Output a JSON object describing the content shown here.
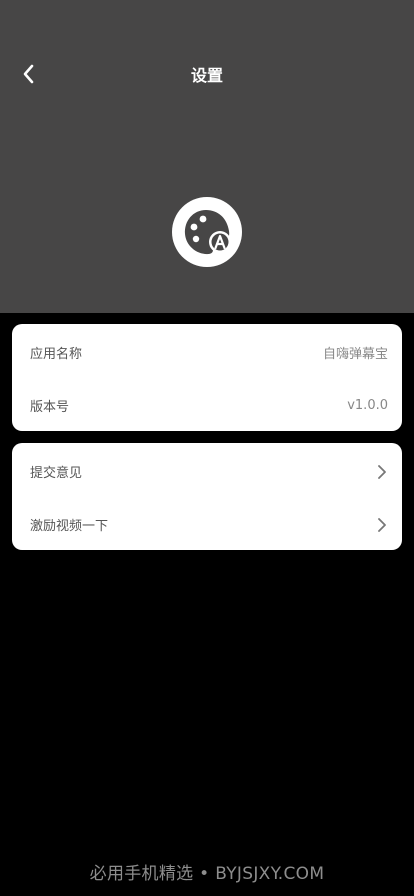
{
  "header": {
    "title": "设置",
    "background": "#474646"
  },
  "icons": {
    "back": "chevron-left-icon",
    "logo": "palette-with-letter-a-icon",
    "arrow": "chevron-right-icon"
  },
  "info_card": {
    "items": [
      {
        "label": "应用名称",
        "value": "自嗨弹幕宝"
      },
      {
        "label": "版本号",
        "value": "v1.0.0"
      }
    ]
  },
  "actions_card": {
    "items": [
      {
        "label": "提交意见"
      },
      {
        "label": "激励视频一下"
      }
    ]
  },
  "footer": {
    "watermark": "必用手机精选 • BYJSJXY.COM"
  }
}
